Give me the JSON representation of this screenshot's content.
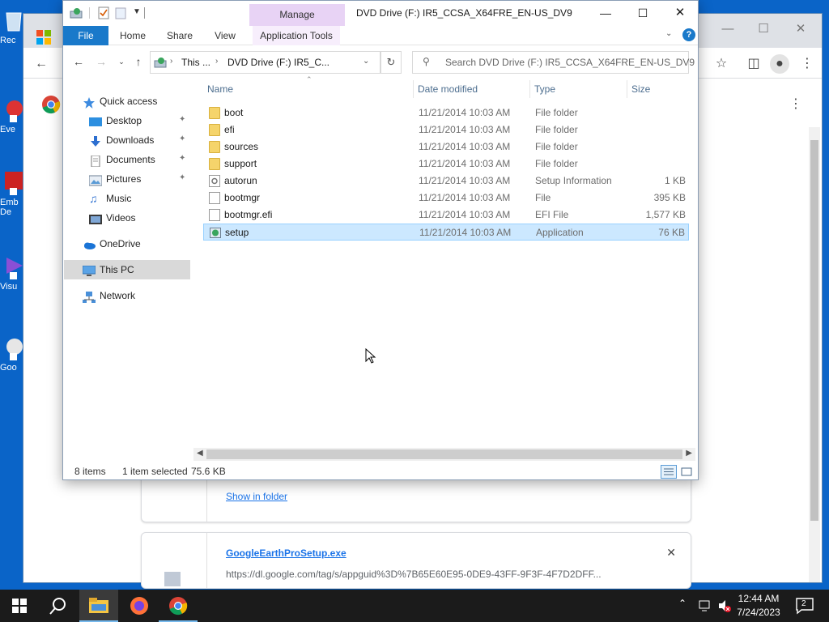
{
  "desktop": {
    "icons": [
      {
        "label": "Rec",
        "icon": "recycle-bin-icon"
      },
      {
        "label": "Eve",
        "icon": "app-shortcut-icon"
      },
      {
        "label": "Emb\nDe",
        "icon": "app-shortcut-icon"
      },
      {
        "label": "Visu",
        "icon": "app-shortcut-icon"
      },
      {
        "label": "Goo",
        "icon": "app-shortcut-icon"
      }
    ]
  },
  "chrome": {
    "downloads": [
      {
        "link": "Show in folder"
      },
      {
        "filename": "GoogleEarthProSetup.exe",
        "url": "https://dl.google.com/tag/s/appguid%3D%7B65E60E95-0DE9-43FF-9F3F-4F7D2DFF..."
      }
    ]
  },
  "explorer": {
    "title": "DVD Drive (F:) IR5_CCSA_X64FRE_EN-US_DV9",
    "context_tab_group": "Manage",
    "ribbon_tabs": [
      "File",
      "Home",
      "Share",
      "View",
      "Application Tools"
    ],
    "address": {
      "segments": [
        "This ...",
        "DVD Drive (F:) IR5_C..."
      ]
    },
    "search_placeholder": "Search DVD Drive (F:) IR5_CCSA_X64FRE_EN-US_DV9",
    "nav": {
      "quick_access": "Quick access",
      "pinned": [
        "Desktop",
        "Downloads",
        "Documents",
        "Pictures"
      ],
      "unpinned": [
        "Music",
        "Videos"
      ],
      "onedrive": "OneDrive",
      "this_pc": "This PC",
      "network": "Network"
    },
    "columns": {
      "name": "Name",
      "date": "Date modified",
      "type": "Type",
      "size": "Size"
    },
    "files": [
      {
        "name": "boot",
        "date": "11/21/2014 10:03 AM",
        "type": "File folder",
        "size": "",
        "kind": "folder"
      },
      {
        "name": "efi",
        "date": "11/21/2014 10:03 AM",
        "type": "File folder",
        "size": "",
        "kind": "folder"
      },
      {
        "name": "sources",
        "date": "11/21/2014 10:03 AM",
        "type": "File folder",
        "size": "",
        "kind": "folder"
      },
      {
        "name": "support",
        "date": "11/21/2014 10:03 AM",
        "type": "File folder",
        "size": "",
        "kind": "folder"
      },
      {
        "name": "autorun",
        "date": "11/21/2014 10:03 AM",
        "type": "Setup Information",
        "size": "1 KB",
        "kind": "setup-info"
      },
      {
        "name": "bootmgr",
        "date": "11/21/2014 10:03 AM",
        "type": "File",
        "size": "395 KB",
        "kind": "file"
      },
      {
        "name": "bootmgr.efi",
        "date": "11/21/2014 10:03 AM",
        "type": "EFI File",
        "size": "1,577 KB",
        "kind": "file"
      },
      {
        "name": "setup",
        "date": "11/21/2014 10:03 AM",
        "type": "Application",
        "size": "76 KB",
        "kind": "application",
        "selected": true
      }
    ],
    "status": {
      "items": "8 items",
      "selected": "1 item selected",
      "size": "75.6 KB"
    }
  },
  "taskbar": {
    "time": "12:44 AM",
    "date": "7/24/2023",
    "notification_count": "2"
  },
  "colors": {
    "desktop": "#0a64c8",
    "accent": "#1979ca",
    "selection": "#cce8ff",
    "context_tab": "#e8d3f5"
  }
}
